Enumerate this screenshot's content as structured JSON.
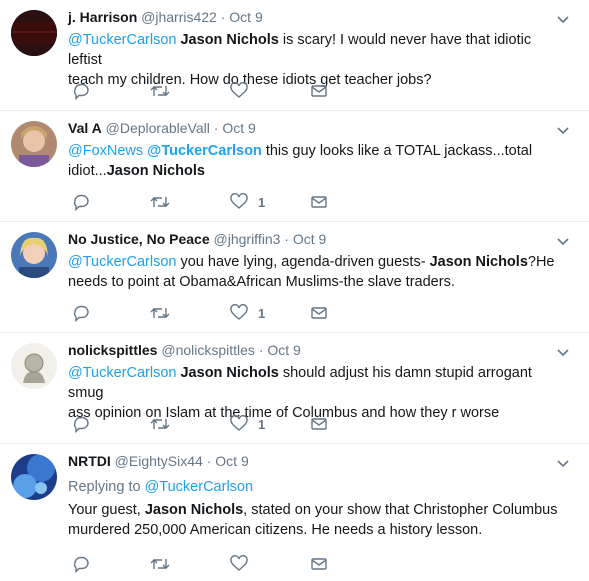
{
  "tweets": [
    {
      "name": "j. Harrison",
      "handle": "@jharris422",
      "time": "Oct 9",
      "avatar_text": "AMERICANS COME FIRST",
      "line1": {
        "mention1": "@TuckerCarlson",
        "bold": " Jason Nichols",
        "rest": " is scary! I would never have that idiotic leftist"
      },
      "line2": "teach my children. How do these idiots get teacher jobs?",
      "likes": ""
    },
    {
      "name": "Val A",
      "handle": "@DeplorableVall",
      "time": "Oct 9",
      "line1": {
        "mention1": "@FoxNews",
        "mention2": " @TuckerCarlson",
        "rest": " this guy looks like a TOTAL jackass...total"
      },
      "line2": {
        "plain": "idiot...",
        "bold": "Jason Nichols"
      },
      "likes": "1"
    },
    {
      "name": "No Justice, No Peace",
      "handle": "@jhgriffin3",
      "time": "Oct 9",
      "line1": {
        "mention1": "@TuckerCarlson",
        "rest": " you have lying, agenda-driven guests- ",
        "bold": "Jason Nichols",
        "rest2": "?He"
      },
      "line2": "needs to point at Obama&African Muslims-the slave traders.",
      "likes": "1"
    },
    {
      "name": "nolickspittles",
      "handle": "@nolickspittles",
      "time": "Oct 9",
      "line1": {
        "mention1": "@TuckerCarlson",
        "bold": " Jason Nichols",
        "rest": " should adjust his damn stupid arrogant smug"
      },
      "line2": "ass opinion on Islam at the time of Columbus and how they r worse",
      "likes": "1"
    },
    {
      "name": "NRTDI",
      "handle": "@EightySix44",
      "time": "Oct 9",
      "replying_prefix": "Replying to ",
      "replying_to": "@TuckerCarlson",
      "line1": {
        "plain": "Your guest, ",
        "bold": "Jason Nichols",
        "rest": ", stated on your show that Christopher Columbus"
      },
      "line2": "murdered 250,000 American citizens.  He needs a history lesson.",
      "likes": ""
    }
  ],
  "separator": " · ",
  "icons": [
    "reply-icon",
    "retweet-icon",
    "like-icon",
    "message-icon",
    "chevron-down-icon"
  ],
  "colors": {
    "mention": "#1da1f2",
    "secondary": "#657786",
    "text": "#14171a",
    "divider": "#e6ecf0"
  }
}
